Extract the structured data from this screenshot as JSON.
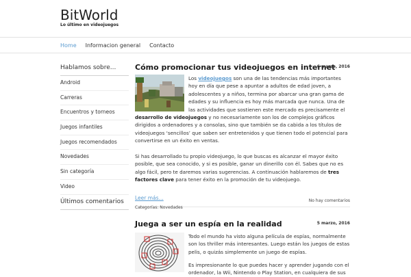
{
  "site": {
    "title": "BitWorld",
    "tagline": "Lo último en videojuegos"
  },
  "nav": {
    "items": [
      "Home",
      "Informacion general",
      "Contacto"
    ],
    "active_index": 0
  },
  "sidebar": {
    "heading": "Hablamos sobre...",
    "items": [
      "Android",
      "Carreras",
      "Encuentros y torneos",
      "Juegos infantiles",
      "Juegos recomendados",
      "Novedades",
      "Sin categoría",
      "Video"
    ],
    "heading2": "Últimos comentarios"
  },
  "posts": [
    {
      "title": "Cómo promocionar tus videojuegos en internet",
      "date": "6 marzo, 2016",
      "p1": {
        "a": "Los ",
        "link": "videojuegos",
        "b": " son una de las tendencias más importantes hoy en día que pese a apuntar a adultos de edad joven, a adolescentes y a niños, termina por abarcar una gran gama de edades y su influencia es hoy más marcada que nunca. Una de las actividades que sostienen este mercado es precisamente el ",
        "bold": "desarrollo de videojuegos",
        "c": " y no necesariamente son los de complejos gráficos dirigidos a ordenadores y a consolas, sino que también se da cabida a los títulos de videojuegos ‘sencillos’ que saben ser entretenidos y que tienen todo el potencial para convertirse en un éxito en ventas."
      },
      "p2": {
        "a": "Si has desarrollado tu propio videojuego, lo que buscas es alcanzar el mayor éxito posible, que sea conocido, y si es posible, ganar un dinerillo con él. Sabes que no es algo fácil, pero te daremos varias sugerencias. A continuación hablaremos de ",
        "bold": "tres factores clave",
        "c": " para tener éxito en la promoción de tu videojuego."
      },
      "read_more": "Leer más...",
      "categories_label": "Categorías: ",
      "category": "Novedades",
      "comments": "No hay comentarios"
    },
    {
      "title": "Juega a ser un espía en la realidad",
      "date": "5 marzo, 2016",
      "p1": "Todo el mundo ha visto alguna película de espías, normalmente son los thriller más interesantes. Luego están los juegos de estas pelis, o quizás simplemente un juego de espías.",
      "p2": "Es impresionante lo que puedes hacer y aprender jugando con el ordenador, la Wii, Nintendo o Play Station, en cualquiera de sus"
    }
  ],
  "colors": {
    "accent": "#5b9bd0",
    "text": "#333333",
    "border": "#e2e2e2"
  }
}
